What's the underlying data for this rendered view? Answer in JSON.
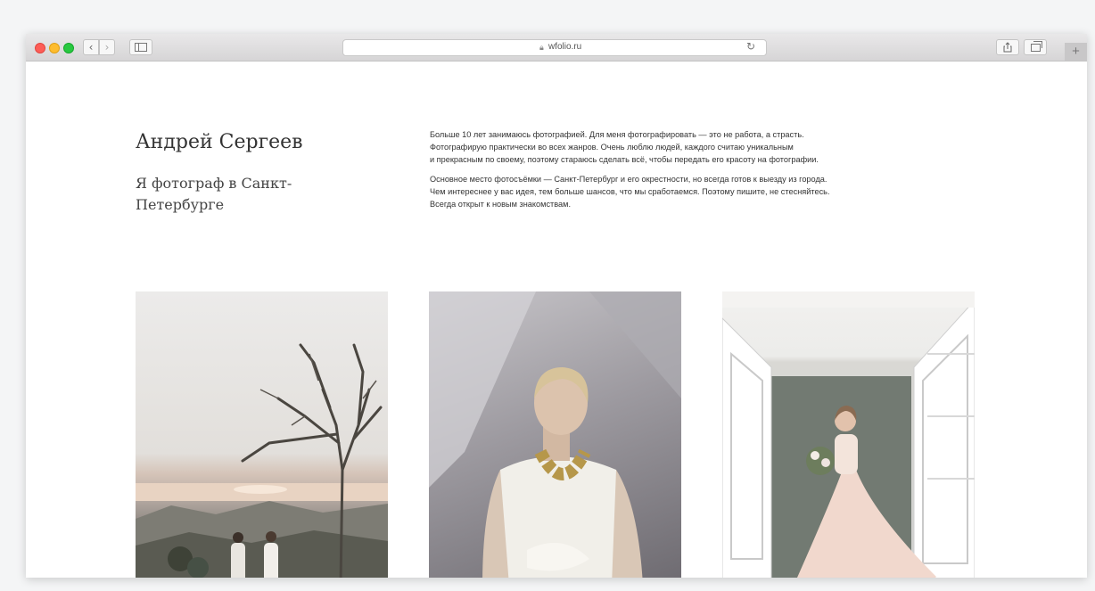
{
  "browser": {
    "url": "wfolio.ru",
    "nav_back_glyph": "‹",
    "nav_forward_glyph": "›",
    "new_tab_glyph": "+",
    "icons": [
      "chevron-left-icon",
      "chevron-right-icon",
      "sidebar-icon",
      "lock-icon",
      "reload-icon",
      "share-icon",
      "tabs-icon",
      "plus-icon"
    ]
  },
  "profile": {
    "name": "Андрей Сергеев",
    "subtitle": "Я фотограф в Санкт-Петербурге"
  },
  "about": {
    "paragraph1": "Больше 10 лет занимаюсь фотографией. Для меня фотографировать — это не работа, а страсть.\nФотографирую практически во всех жанров. Очень люблю людей, каждого считаю уникальным\nи прекрасным по своему, поэтому стараюсь сделать всё, чтобы передать его красоту на фотографии.",
    "paragraph2": "Основное место фотосъёмки — Санкт-Петербург и его окрестности, но всегда готов к выезду из города.\nЧем интереснее у вас идея, тем больше шансов, что мы сработаемся. Поэтому пишите, не стесняйтесь.\nВсегда открыт к новым знакомствам."
  },
  "colors": {
    "background": "#f4f5f6",
    "window": "#ffffff",
    "text": "#333333",
    "traffic_red": "#fd5d57",
    "traffic_yellow": "#febc2e",
    "traffic_green": "#28c840"
  }
}
